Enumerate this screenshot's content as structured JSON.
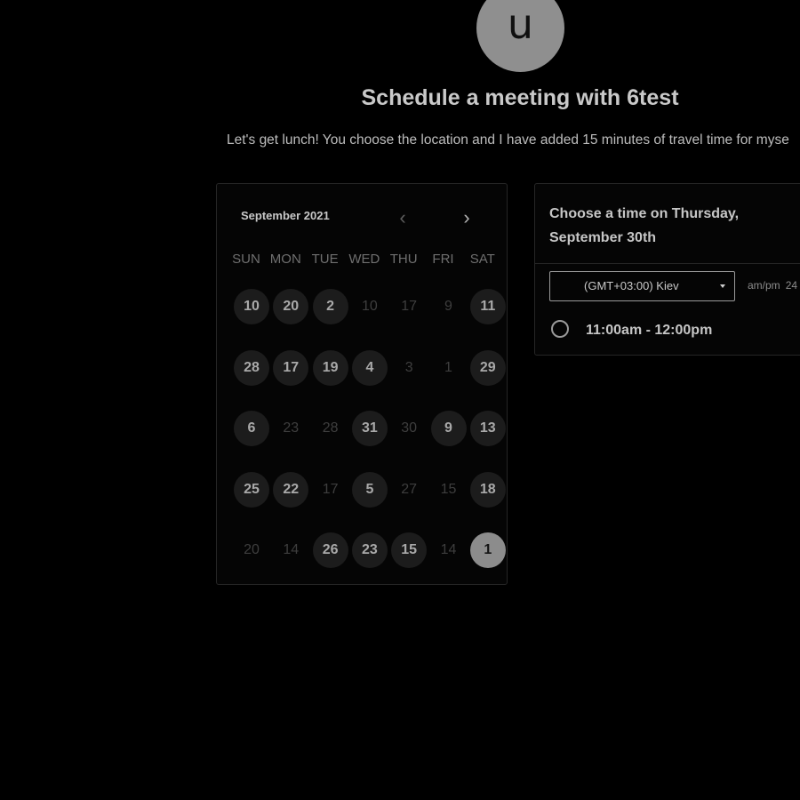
{
  "header": {
    "avatar_letter": "u",
    "title": "Schedule a meeting with 6test",
    "description": "Let's get lunch! You choose the location and I have added 15 minutes of travel time for myse"
  },
  "calendar": {
    "month_label": "September 2021",
    "prev_icon": "chevron-left-icon",
    "next_icon": "chevron-right-icon",
    "weekdays": [
      "SUN",
      "MON",
      "TUE",
      "WED",
      "THU",
      "FRI",
      "SAT"
    ],
    "weeks": [
      [
        {
          "d": "10",
          "s": "avail"
        },
        {
          "d": "20",
          "s": "avail"
        },
        {
          "d": "2",
          "s": "avail"
        },
        {
          "d": "10",
          "s": "off"
        },
        {
          "d": "17",
          "s": "off"
        },
        {
          "d": "9",
          "s": "off"
        },
        {
          "d": "11",
          "s": "avail"
        }
      ],
      [
        {
          "d": "28",
          "s": "avail"
        },
        {
          "d": "17",
          "s": "avail"
        },
        {
          "d": "19",
          "s": "avail"
        },
        {
          "d": "4",
          "s": "avail"
        },
        {
          "d": "3",
          "s": "off"
        },
        {
          "d": "1",
          "s": "off"
        },
        {
          "d": "29",
          "s": "avail"
        }
      ],
      [
        {
          "d": "6",
          "s": "avail"
        },
        {
          "d": "23",
          "s": "off"
        },
        {
          "d": "28",
          "s": "off"
        },
        {
          "d": "31",
          "s": "avail"
        },
        {
          "d": "30",
          "s": "off"
        },
        {
          "d": "9",
          "s": "avail"
        },
        {
          "d": "13",
          "s": "avail"
        }
      ],
      [
        {
          "d": "25",
          "s": "avail"
        },
        {
          "d": "22",
          "s": "avail"
        },
        {
          "d": "17",
          "s": "off"
        },
        {
          "d": "5",
          "s": "avail"
        },
        {
          "d": "27",
          "s": "off"
        },
        {
          "d": "15",
          "s": "off"
        },
        {
          "d": "18",
          "s": "avail"
        }
      ],
      [
        {
          "d": "20",
          "s": "off"
        },
        {
          "d": "14",
          "s": "off"
        },
        {
          "d": "26",
          "s": "avail"
        },
        {
          "d": "23",
          "s": "avail"
        },
        {
          "d": "15",
          "s": "avail"
        },
        {
          "d": "14",
          "s": "off"
        },
        {
          "d": "1",
          "s": "sel"
        }
      ]
    ]
  },
  "times": {
    "heading": "Choose a time on Thursday, September 30th",
    "timezone": "(GMT+03:00) Kiev",
    "format_ampm": "am/pm",
    "format_24": "24",
    "slots": [
      "11:00am - 12:00pm"
    ]
  }
}
